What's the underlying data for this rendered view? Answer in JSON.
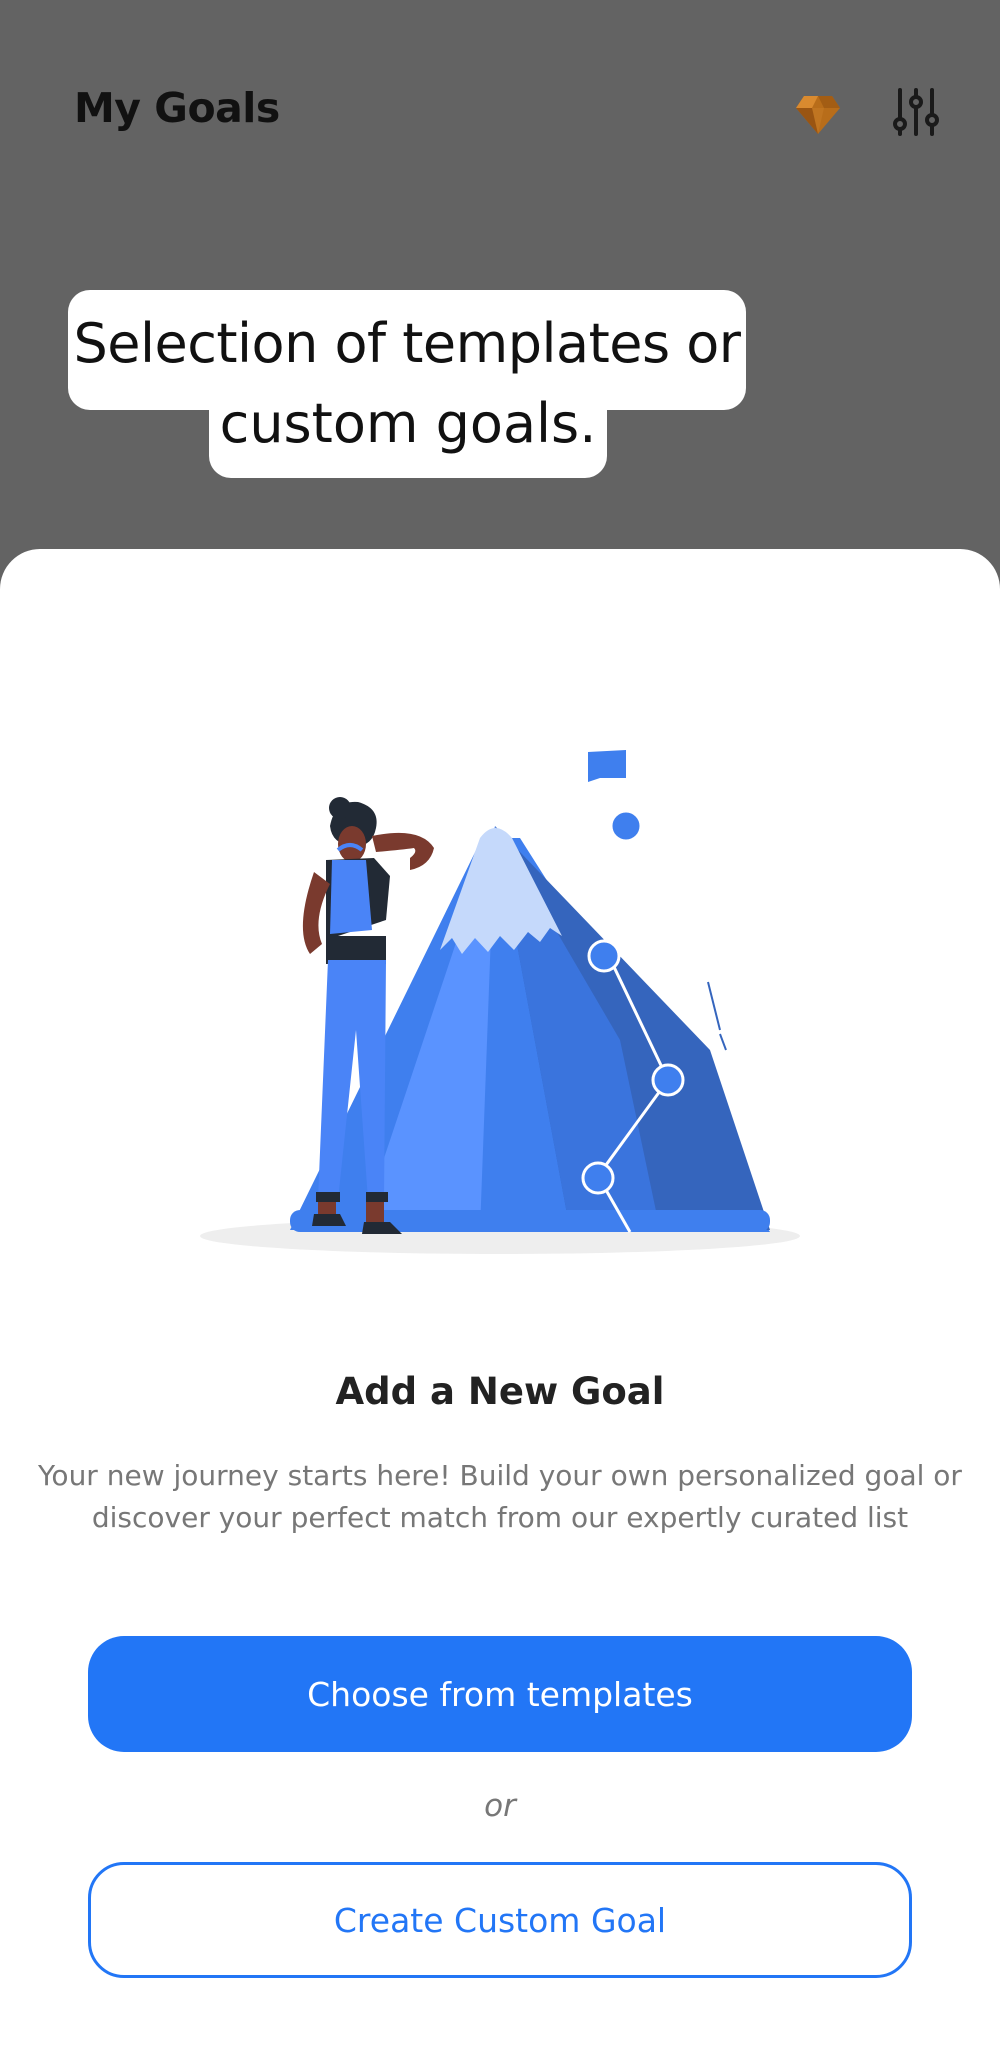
{
  "header": {
    "title": "My Goals",
    "premium_icon": "gem-icon",
    "filter_icon": "sliders-icon"
  },
  "caption": {
    "line1": "Selection of templates or",
    "line2": "custom goals."
  },
  "sheet": {
    "illustration_icon": "person-looking-at-mountain-illustration",
    "title": "Add a New Goal",
    "description": "Your new journey starts here! Build your own personalized goal or discover your perfect match from our expertly curated list",
    "primary_button": "Choose from templates",
    "separator": "or",
    "secondary_button": "Create Custom Goal"
  },
  "colors": {
    "accent": "#2276f6",
    "backdrop": "#636363",
    "gem": "#c8761e"
  }
}
